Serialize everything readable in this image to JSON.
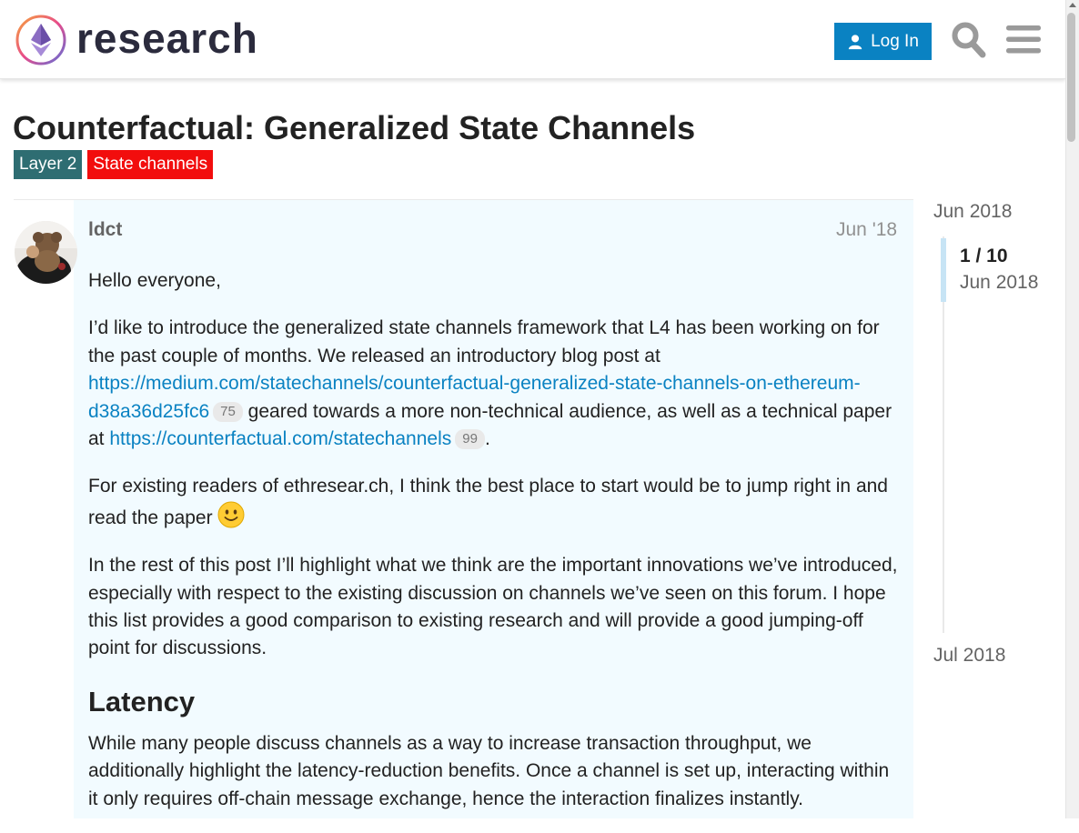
{
  "header": {
    "site_name": "research",
    "login_label": "Log In"
  },
  "topic": {
    "title": "Counterfactual: Generalized State Channels",
    "tags": [
      {
        "label": "Layer 2",
        "color": "#2e6d72"
      },
      {
        "label": "State channels",
        "color": "#f20d0d"
      }
    ]
  },
  "post": {
    "username": "ldct",
    "date": "Jun '18",
    "p1": "Hello everyone,",
    "p2_text1": "I’d like to introduce the generalized state channels framework that L4 has been working on for the past couple of months. We released an introductory blog post at ",
    "p2_link1": "https://medium.com/statechannels/counterfactual-generalized-state-channels-on-ethereum-d38a36d25fc6",
    "p2_link1_clicks": "75",
    "p2_text2": " geared towards a more non-technical audience, as well as a technical paper at ",
    "p2_link2": "https://counterfactual.com/statechannels",
    "p2_link2_clicks": "99",
    "p2_text3": ".",
    "p3": "For existing readers of ethresear.ch, I think the best place to start would be to jump right in and read the paper ",
    "p4": "In the rest of this post I’ll highlight what we think are the important innovations we’ve introduced, especially with respect to the existing discussion on channels we’ve seen on this forum. I hope this list provides a good comparison to existing research and will provide a good jumping-off point for discussions.",
    "h_latency": "Latency",
    "p5": "While many people discuss channels as a way to increase transaction throughput, we additionally highlight the latency-reduction benefits. Once a channel is set up, interacting within it only requires off-chain message exchange, hence the interaction finalizes instantly."
  },
  "timeline": {
    "start": "Jun 2018",
    "position": "1 / 10",
    "position_date": "Jun 2018",
    "end": "Jul 2018"
  },
  "colors": {
    "accent": "#0a82c2",
    "post_background": "#f2fbff"
  },
  "icons": [
    "ethereum-research-logo",
    "user-icon",
    "search-icon",
    "hamburger-menu-icon",
    "slightly-smiling-face-emoji"
  ]
}
